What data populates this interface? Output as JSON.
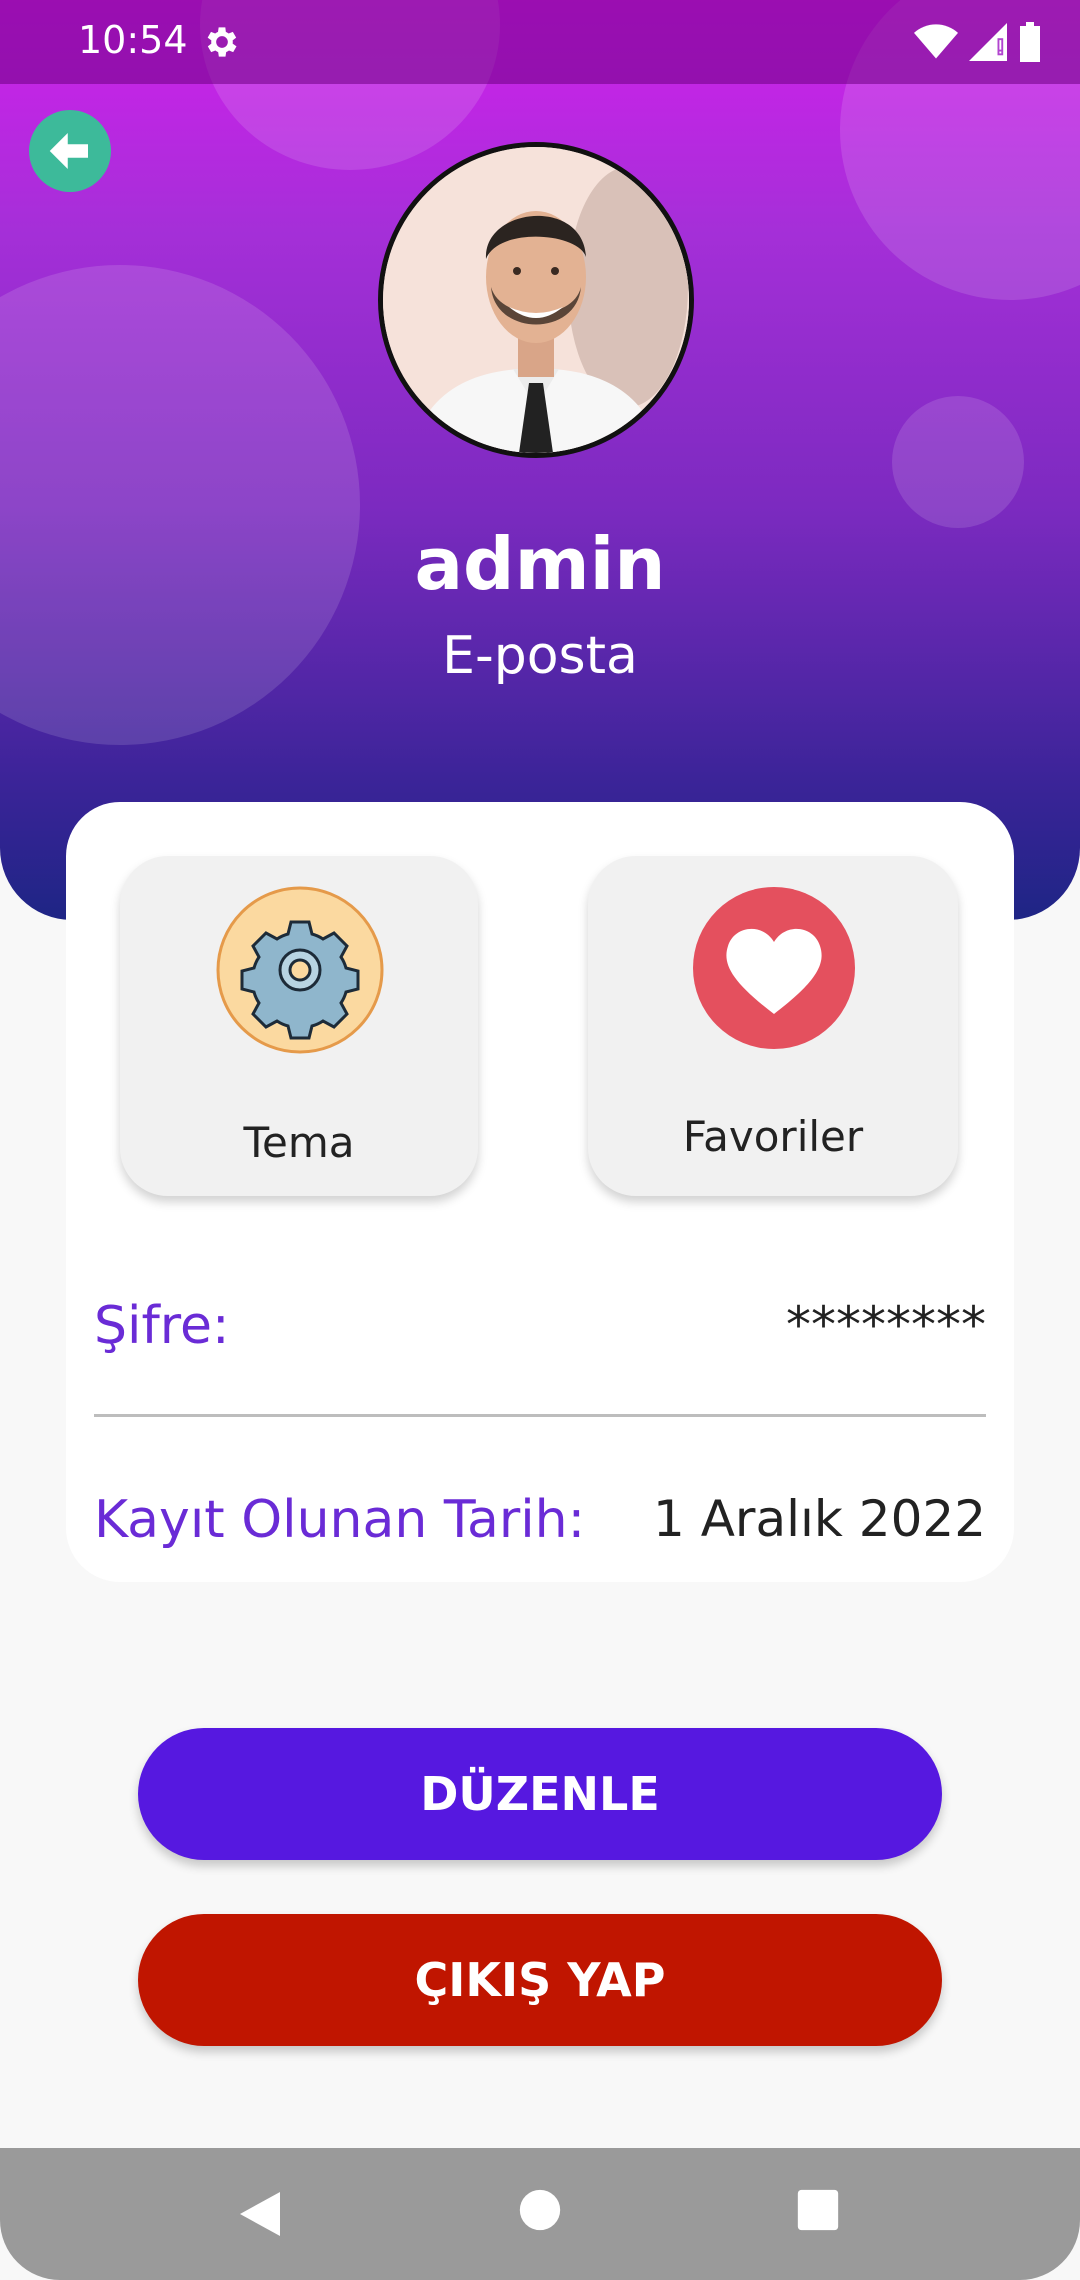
{
  "status_bar": {
    "time": "10:54"
  },
  "profile": {
    "username": "admin",
    "email_label": "E-posta"
  },
  "tiles": [
    {
      "label": "Tema",
      "icon": "gear-icon"
    },
    {
      "label": "Favoriler",
      "icon": "heart-icon"
    }
  ],
  "details": {
    "password_label": "Şifre:",
    "password_value": "********",
    "date_label": "Kayıt Olunan Tarih:",
    "date_value": "1 Aralık 2022"
  },
  "buttons": {
    "edit_label": "DÜZENLE",
    "logout_label": "ÇIKIŞ YAP"
  },
  "colors": {
    "accent_purple": "#5618e0",
    "logout_red": "#c01500",
    "label_purple": "#6a2bd6",
    "back_button": "#3dba9a"
  }
}
